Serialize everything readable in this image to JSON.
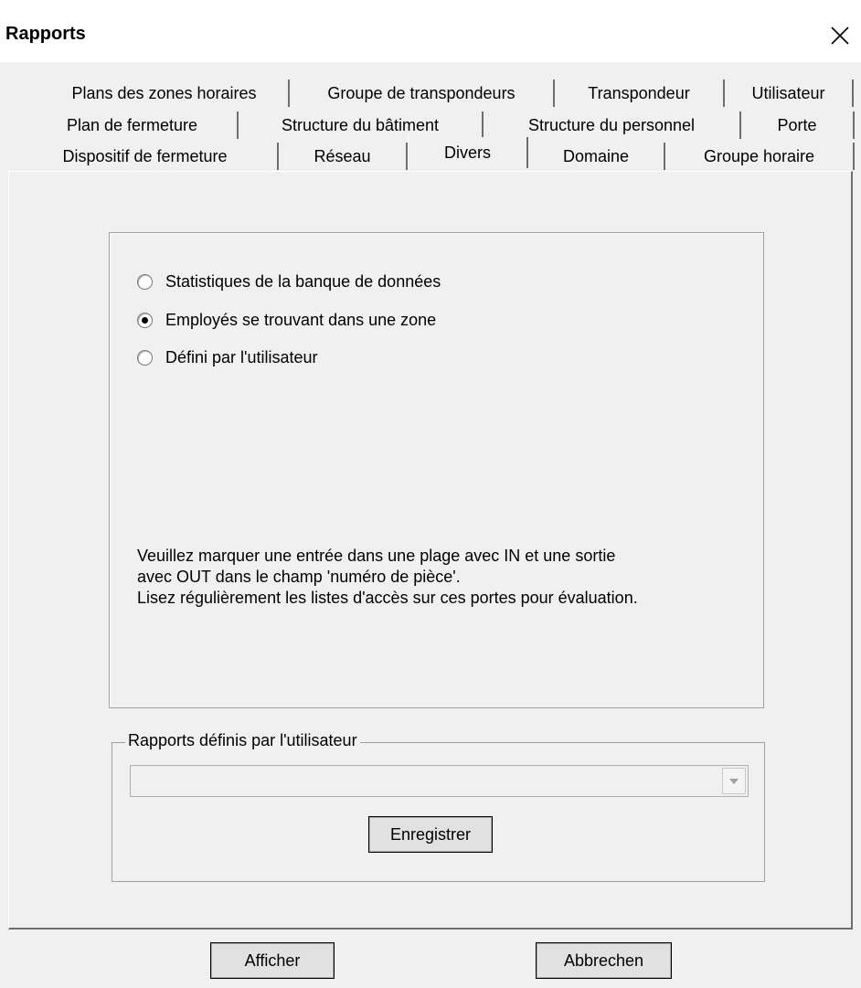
{
  "window": {
    "title": "Rapports"
  },
  "tabs": {
    "row1": [
      "Plans des zones horaires",
      "Groupe de transpondeurs",
      "Transpondeur",
      "Utilisateur"
    ],
    "row2": [
      "Plan de fermeture",
      "Structure du bâtiment",
      "Structure du personnel",
      "Porte"
    ],
    "row3": [
      "Dispositif de fermeture",
      "Réseau",
      "Divers",
      "Domaine",
      "Groupe horaire"
    ],
    "selected": "Divers"
  },
  "options": [
    {
      "label": "Statistiques de la banque de données",
      "checked": false
    },
    {
      "label": "Employés se trouvant dans une zone",
      "checked": true
    },
    {
      "label": "Défini par l'utilisateur",
      "checked": false
    }
  ],
  "info": {
    "line1": "Veuillez marquer une entrée dans une plage avec IN et une sortie",
    "line2": "avec OUT dans le champ 'numéro de pièce'.",
    "line3": "Lisez régulièrement les listes d'accès sur ces portes pour évaluation."
  },
  "user_reports": {
    "legend": "Rapports définis par l'utilisateur",
    "selected_value": "",
    "save_label": "Enregistrer"
  },
  "footer": {
    "show_label": "Afficher",
    "cancel_label": "Abbrechen"
  }
}
